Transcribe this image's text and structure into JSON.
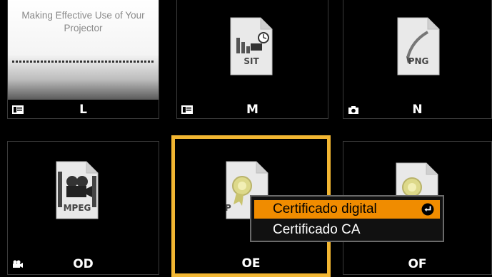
{
  "tiles": [
    {
      "label": "L",
      "type_icon": "presentation-icon",
      "preview": {
        "title": "Making Effective Use of Your Projector"
      }
    },
    {
      "label": "M",
      "type_icon": "presentation-icon",
      "file_tag": "SIT",
      "file_icon": "sit-file-icon"
    },
    {
      "label": "N",
      "type_icon": "camera-icon",
      "file_tag": "PNG",
      "file_icon": "png-file-icon"
    },
    {
      "label": "OD",
      "type_icon": "video-camera-icon",
      "file_tag": "MPEG",
      "file_icon": "mpeg-file-icon"
    },
    {
      "label": "OE",
      "file_tag": "P",
      "file_icon": "certificate-file-icon",
      "selected": true
    },
    {
      "label": "OF",
      "file_icon": "certificate-file-icon"
    }
  ],
  "context_menu": {
    "items": [
      {
        "label": "Certificado digital",
        "selected": true,
        "icon": "enter-icon"
      },
      {
        "label": "Certificado CA",
        "selected": false
      }
    ]
  },
  "colors": {
    "selection_border": "#f2b632",
    "menu_highlight": "#f08c00",
    "background": "#000000"
  }
}
